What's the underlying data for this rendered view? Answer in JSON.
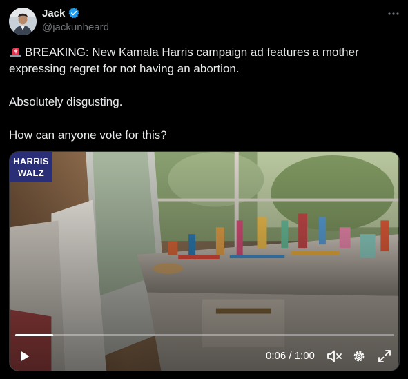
{
  "author": {
    "name": "Jack",
    "handle": "@jackunheard",
    "verified": true
  },
  "tweet": {
    "line1": "BREAKING: New Kamala Harris campaign ad features a mother expressing regret for not having an abortion.",
    "line2": "Absolutely disgusting.",
    "line3": "How can anyone vote for this?"
  },
  "video": {
    "badge_top": "HARRIS",
    "badge_bottom": "WALZ",
    "time_display": "0:06 / 1:00",
    "progress_fraction": 0.1,
    "muted": true
  },
  "colors": {
    "background": "#000000",
    "text": "#e7e9ea",
    "secondary": "#71767b",
    "verified": "#1d9bf0",
    "badge": "#2a2e77"
  },
  "icons": [
    "verified-icon",
    "more-icon",
    "siren-emoji",
    "play-icon",
    "mute-icon",
    "settings-icon",
    "fullscreen-icon"
  ]
}
